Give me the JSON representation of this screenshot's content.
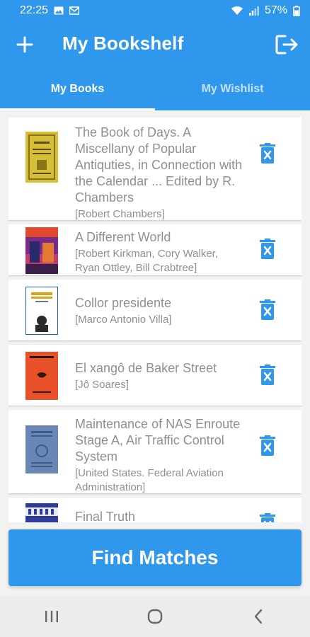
{
  "status": {
    "time": "22:25",
    "battery": "57%",
    "left_icons": [
      "image-icon",
      "email-icon"
    ],
    "right_icons": [
      "wifi-icon",
      "signal-icon",
      "battery-icon"
    ]
  },
  "app_bar": {
    "title": "My Bookshelf",
    "add_icon": "plus-icon",
    "logout_icon": "logout-icon"
  },
  "tabs": [
    {
      "label": "My Books",
      "active": true
    },
    {
      "label": "My Wishlist",
      "active": false
    }
  ],
  "books": [
    {
      "title": "The Book of Days. A Miscellany of Popular Antiquties, in Connection with the Calendar ... Edited by R. Chambers",
      "author": "[Robert Chambers]"
    },
    {
      "title": "A Different World",
      "author": "[Robert Kirkman, Cory Walker, Ryan Ottley, Bill Crabtree]"
    },
    {
      "title": "Collor presidente",
      "author": "[Marco Antonio Villa]"
    },
    {
      "title": "El xangô de Baker Street",
      "author": "[Jô Soares]"
    },
    {
      "title": "Maintenance of NAS Enroute Stage A, Air Traffic Control System",
      "author": "[United States. Federal Aviation Administration]"
    },
    {
      "title": "Final Truth",
      "author": ""
    }
  ],
  "find_button": {
    "label": "Find Matches"
  },
  "nav": [
    "recent-apps-icon",
    "home-icon",
    "back-icon"
  ],
  "colors": {
    "primary": "#2f97ec",
    "text_gray": "#8f8f8f",
    "background": "#f2f2f2"
  }
}
